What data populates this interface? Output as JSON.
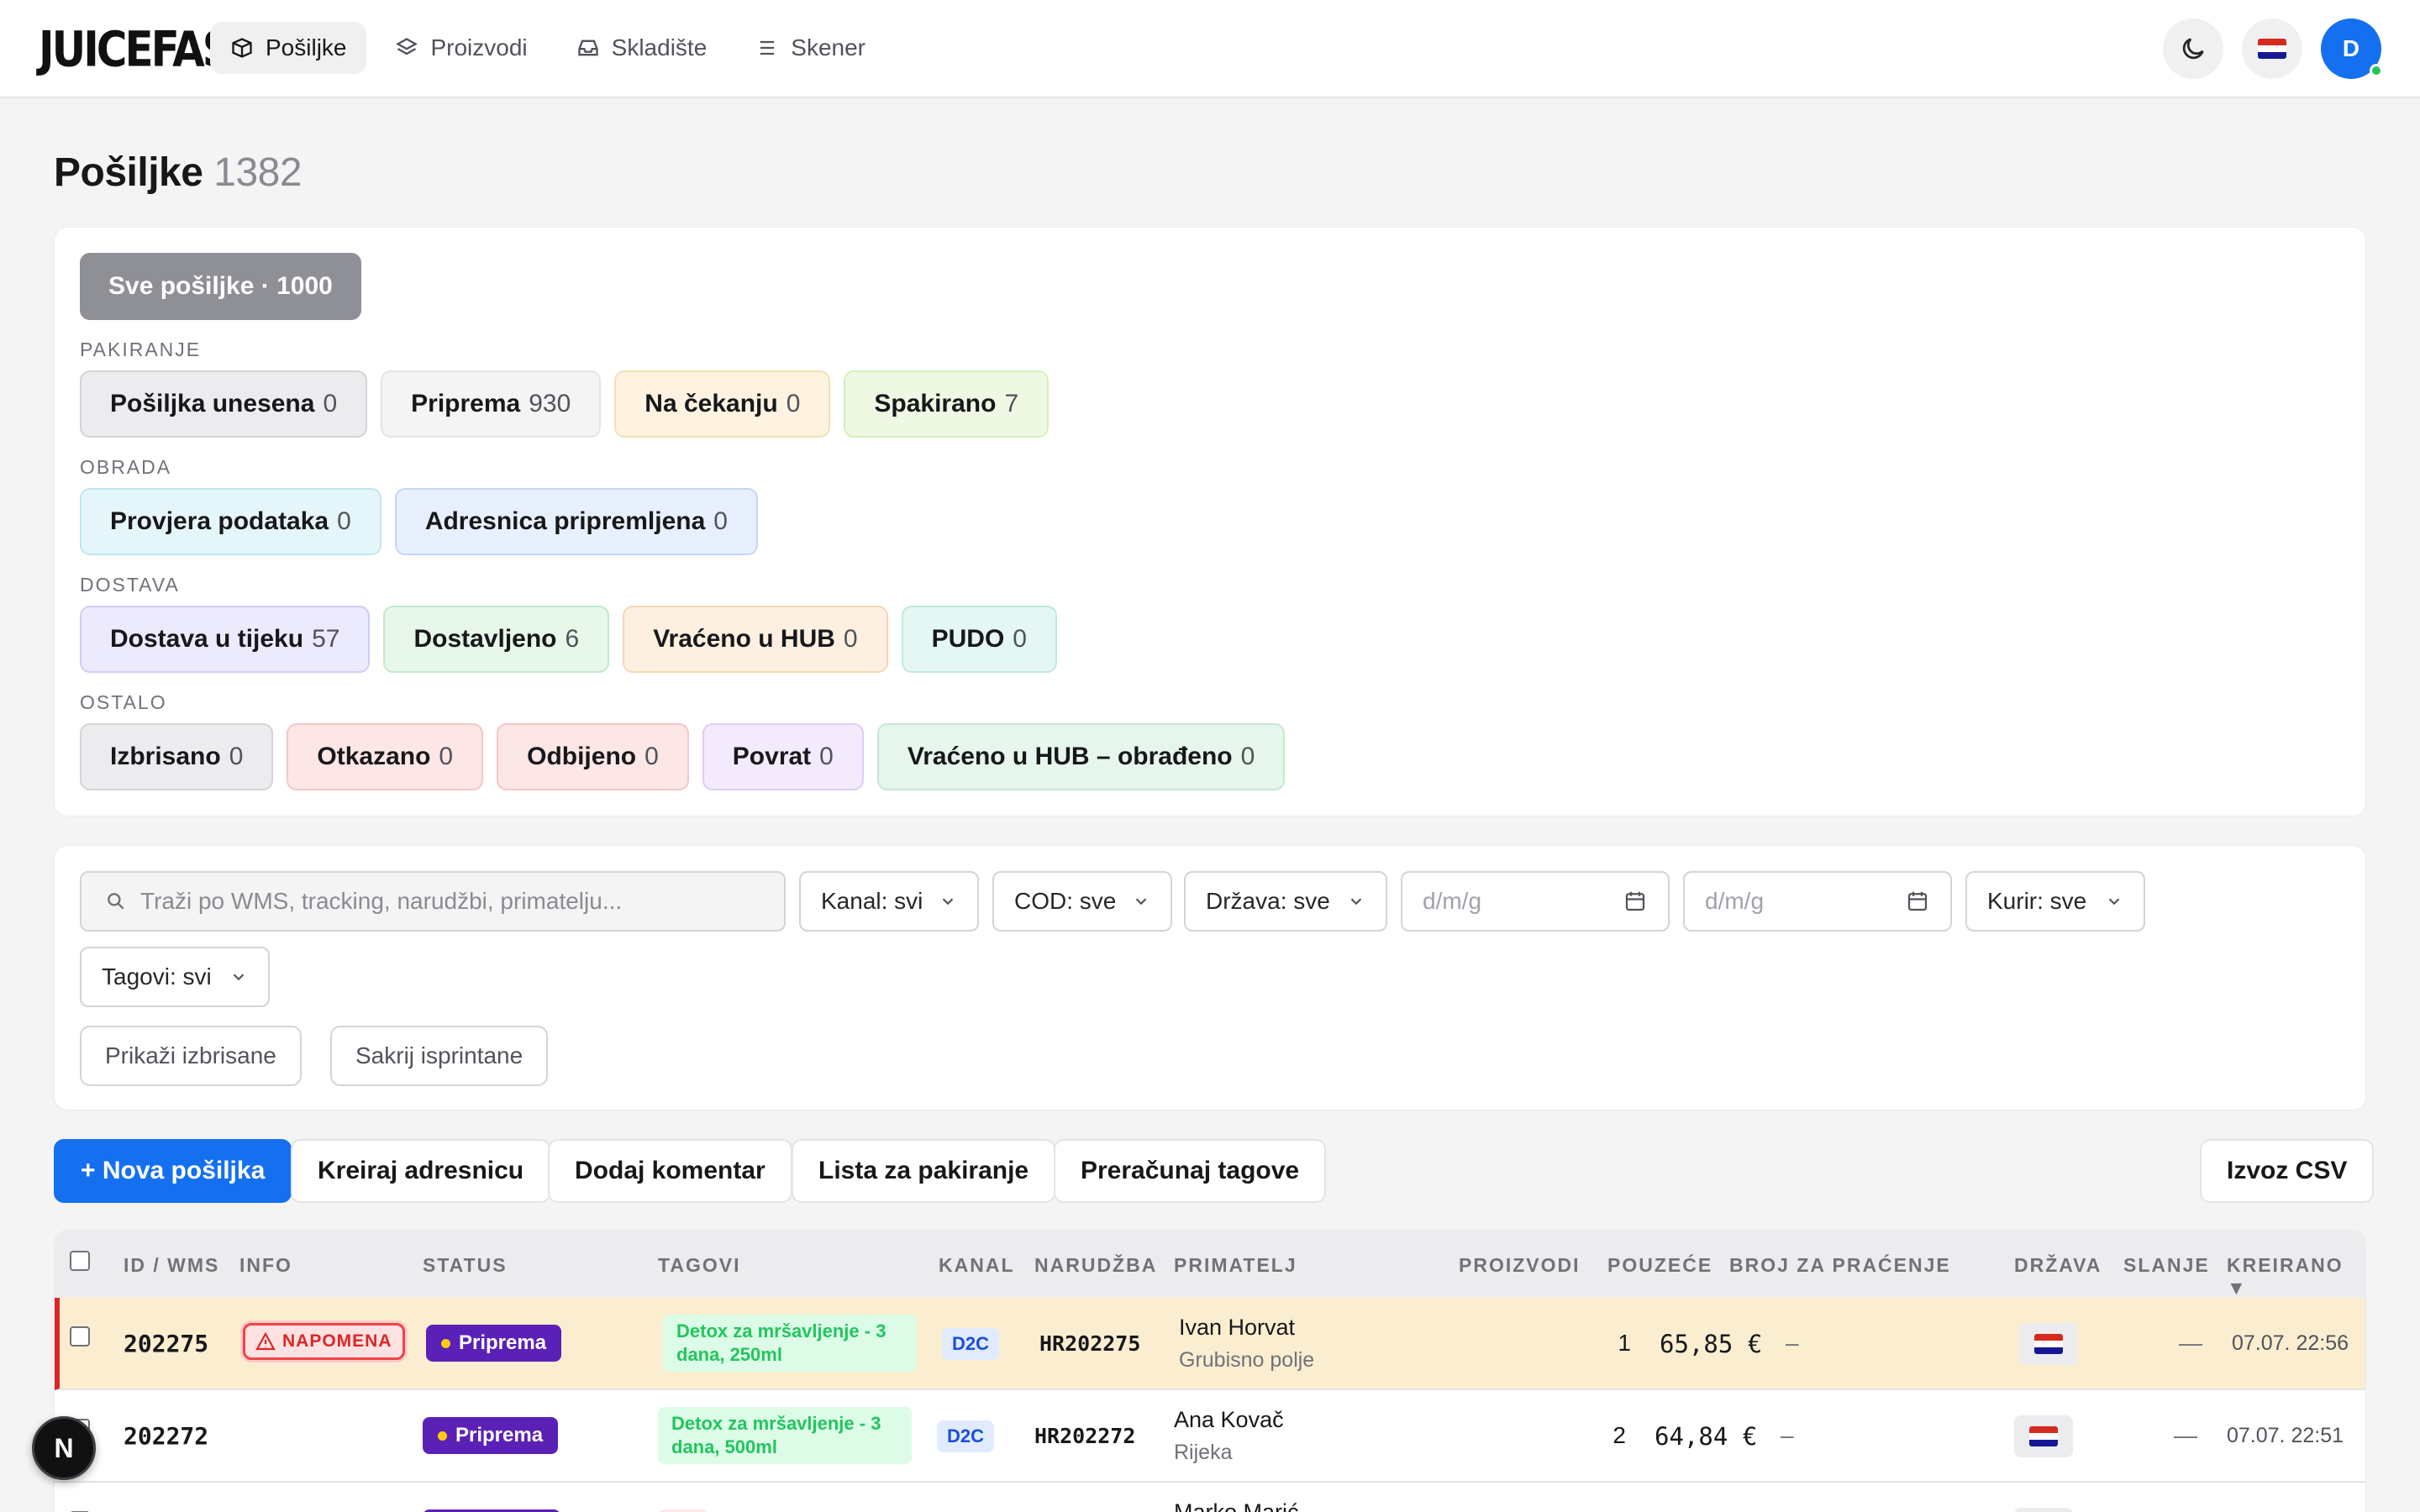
{
  "app": {
    "logo": "JUICEFAST"
  },
  "nav": [
    {
      "label": "Pošiljke",
      "icon": "package-icon",
      "active": true
    },
    {
      "label": "Proizvodi",
      "icon": "layers-icon",
      "active": false
    },
    {
      "label": "Skladište",
      "icon": "inbox-icon",
      "active": false
    },
    {
      "label": "Skener",
      "icon": "menu-icon",
      "active": false
    }
  ],
  "user": {
    "initial": "D"
  },
  "page": {
    "title": "Pošiljke",
    "count": "1382"
  },
  "status": {
    "all_label": "Sve pošiljke · 1000",
    "groups": [
      {
        "label": "PAKIRANJE",
        "chips": [
          {
            "label": "Pošiljka unesena",
            "count": "0",
            "bg": "#ececee",
            "border": "#d4d4d8"
          },
          {
            "label": "Priprema",
            "count": "930",
            "bg": "#f4f4f5",
            "border": "#e4e4e7"
          },
          {
            "label": "Na čekanju",
            "count": "0",
            "bg": "#fdf3e0",
            "border": "#f5dfb2"
          },
          {
            "label": "Spakirano",
            "count": "7",
            "bg": "#eef8e2",
            "border": "#d6efbf"
          }
        ]
      },
      {
        "label": "OBRADA",
        "chips": [
          {
            "label": "Provjera podataka",
            "count": "0",
            "bg": "#e5f6fb",
            "border": "#bfe6f2"
          },
          {
            "label": "Adresnica pripremljena",
            "count": "0",
            "bg": "#e8f0fd",
            "border": "#c4d7f7"
          }
        ]
      },
      {
        "label": "DOSTAVA",
        "chips": [
          {
            "label": "Dostava u tijeku",
            "count": "57",
            "bg": "#eceafd",
            "border": "#d1ccf6"
          },
          {
            "label": "Dostavljeno",
            "count": "6",
            "bg": "#e7f7ea",
            "border": "#c4e9cb"
          },
          {
            "label": "Vraćeno u HUB",
            "count": "0",
            "bg": "#fdf0e1",
            "border": "#f5d7b4"
          },
          {
            "label": "PUDO",
            "count": "0",
            "bg": "#e4f7f3",
            "border": "#bfe9df"
          }
        ]
      },
      {
        "label": "OSTALO",
        "chips": [
          {
            "label": "Izbrisano",
            "count": "0",
            "bg": "#ececee",
            "border": "#d4d4d8"
          },
          {
            "label": "Otkazano",
            "count": "0",
            "bg": "#fde6e6",
            "border": "#f5c6c6"
          },
          {
            "label": "Odbijeno",
            "count": "0",
            "bg": "#fde6e6",
            "border": "#f5c6c6"
          },
          {
            "label": "Povrat",
            "count": "0",
            "bg": "#f3eafd",
            "border": "#e0ccf6"
          },
          {
            "label": "Vraćeno u HUB – obrađeno",
            "count": "0",
            "bg": "#e6f6ec",
            "border": "#c4e8d1"
          }
        ]
      }
    ]
  },
  "filters": {
    "search_placeholder": "Traži po WMS, tracking, narudžbi, primatelju...",
    "kanal": "Kanal: svi",
    "cod": "COD: sve",
    "drzava": "Država: sve",
    "date_from": "d/m/g",
    "date_to": "d/m/g",
    "kurir": "Kurir: sve",
    "tagovi": "Tagovi: svi",
    "show_deleted": "Prikaži izbrisane",
    "hide_printed": "Sakrij isprintane"
  },
  "actions": {
    "new": "+ Nova pošiljka",
    "create_label": "Kreiraj adresnicu",
    "add_comment": "Dodaj komentar",
    "packing_list": "Lista za pakiranje",
    "recalc_tags": "Preračunaj tagove",
    "export_csv": "Izvoz CSV"
  },
  "table": {
    "columns": [
      "ID / WMS",
      "INFO",
      "STATUS",
      "TAGOVI",
      "KANAL",
      "NARUDŽBA",
      "PRIMATELJ",
      "PROIZVODI",
      "POUZEĆE",
      "BROJ ZA PRAĆENJE",
      "DRŽAVA",
      "SLANJE",
      "KREIRANO ▼"
    ],
    "rows": [
      {
        "id": "202275",
        "info": "NAPOMENA",
        "status": "Priprema",
        "tag": "Detox za mršavljenje - 3 dana, 250ml",
        "kanal": "D2C",
        "order": "HR202275",
        "name": "Ivan Horvat",
        "city": "Grubisno polje",
        "products": "1",
        "cod": "65,85 €",
        "tracking": "–",
        "slanje": "—",
        "created": "07.07. 22:56"
      },
      {
        "id": "202272",
        "info": "",
        "status": "Priprema",
        "tag": "Detox za mršavljenje - 3 dana, 500ml",
        "kanal": "D2C",
        "order": "HR202272",
        "name": "Ana Kovač",
        "city": "Rijeka",
        "products": "2",
        "cod": "64,84 €",
        "tracking": "–",
        "slanje": "—",
        "created": "07.07. 22:51"
      },
      {
        "id": "",
        "info": "",
        "status": "",
        "tag": "",
        "kanal": "",
        "order": "",
        "name": "Marko Marić",
        "city": "",
        "products": "",
        "cod": "",
        "tracking": "",
        "slanje": "",
        "created": ""
      }
    ]
  },
  "fab": {
    "label": "N"
  }
}
